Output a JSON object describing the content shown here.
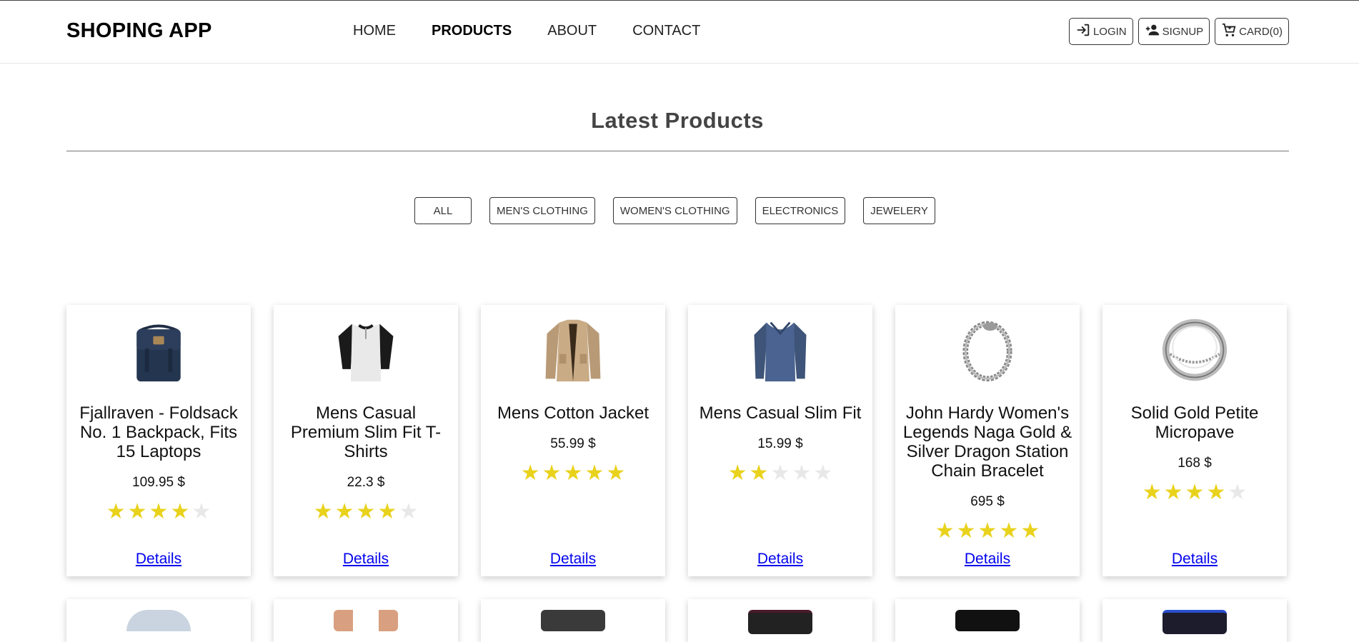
{
  "navbar": {
    "brand": "SHOPING APP",
    "links": [
      {
        "label": "HOME",
        "active": false
      },
      {
        "label": "PRODUCTS",
        "active": true
      },
      {
        "label": "ABOUT",
        "active": false
      },
      {
        "label": "CONTACT",
        "active": false
      }
    ],
    "buttons": [
      {
        "label": "LOGIN",
        "icon": "login-icon"
      },
      {
        "label": "SIGNUP",
        "icon": "user-plus-icon"
      },
      {
        "label": "CARD(0)",
        "icon": "cart-icon"
      }
    ]
  },
  "section": {
    "title": "Latest Products"
  },
  "filters": [
    "ALL",
    "MEN'S CLOTHING",
    "WOMEN'S CLOTHING",
    "ELECTRONICS",
    "JEWELERY"
  ],
  "products": [
    {
      "title": "Fjallraven - Foldsack No. 1 Backpack, Fits 15 Laptops",
      "price": "109.95 $",
      "rating": 4,
      "image": "backpack",
      "details": "Details"
    },
    {
      "title": "Mens Casual Premium Slim Fit T-Shirts",
      "price": "22.3 $",
      "rating": 4,
      "image": "raglan-tshirt",
      "details": "Details"
    },
    {
      "title": "Mens Cotton Jacket",
      "price": "55.99 $",
      "rating": 5,
      "image": "cotton-jacket",
      "details": "Details"
    },
    {
      "title": "Mens Casual Slim Fit",
      "price": "15.99 $",
      "rating": 2,
      "image": "slim-fit-shirt",
      "details": "Details"
    },
    {
      "title": "John Hardy Women's Legends Naga Gold & Silver Dragon Station Chain Bracelet",
      "price": "695 $",
      "rating": 5,
      "image": "chain-bracelet",
      "details": "Details"
    },
    {
      "title": "Solid Gold Petite Micropave",
      "price": "168 $",
      "rating": 4,
      "image": "ring",
      "details": "Details"
    }
  ],
  "colors": {
    "star_on": "#e9d21c",
    "star_off": "#e8e8e8",
    "link": "#0000ee"
  }
}
